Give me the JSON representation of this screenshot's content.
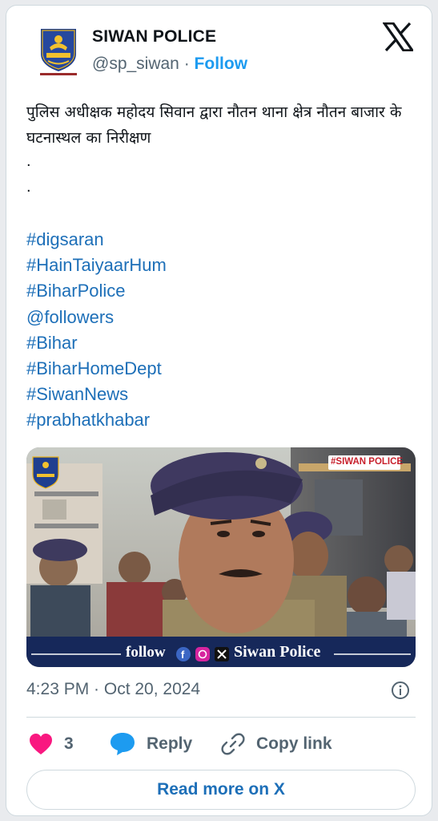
{
  "author": {
    "name": "SIWAN POLICE",
    "handle": "@sp_siwan",
    "separator": " · ",
    "follow_label": "Follow"
  },
  "post": {
    "text": "पुलिस अधीक्षक महोदय सिवान द्वारा नौतन थाना क्षेत्र नौतन बाजार के घटनास्थल का निरीक्षण",
    "dots": [
      ".",
      "."
    ],
    "hashtags": [
      "#digsaran",
      "#HainTaiyaarHum",
      "#BiharPolice",
      "@followers",
      "#Bihar",
      "#BiharHomeDept",
      "#SiwanNews",
      "#prabhatkhabar"
    ]
  },
  "media": {
    "tag_label": "#SIWAN POLICE",
    "follow_text": "follow",
    "brand_text": "Siwan Police"
  },
  "meta": {
    "timestamp": "4:23 PM · Oct 20, 2024"
  },
  "actions": {
    "like_count": "3",
    "reply_label": "Reply",
    "copy_label": "Copy link",
    "read_more_label": "Read more on X"
  },
  "colors": {
    "accent": "#1d9bf0",
    "link": "#1d6fb8",
    "heart": "#f91880",
    "muted": "#536471"
  }
}
